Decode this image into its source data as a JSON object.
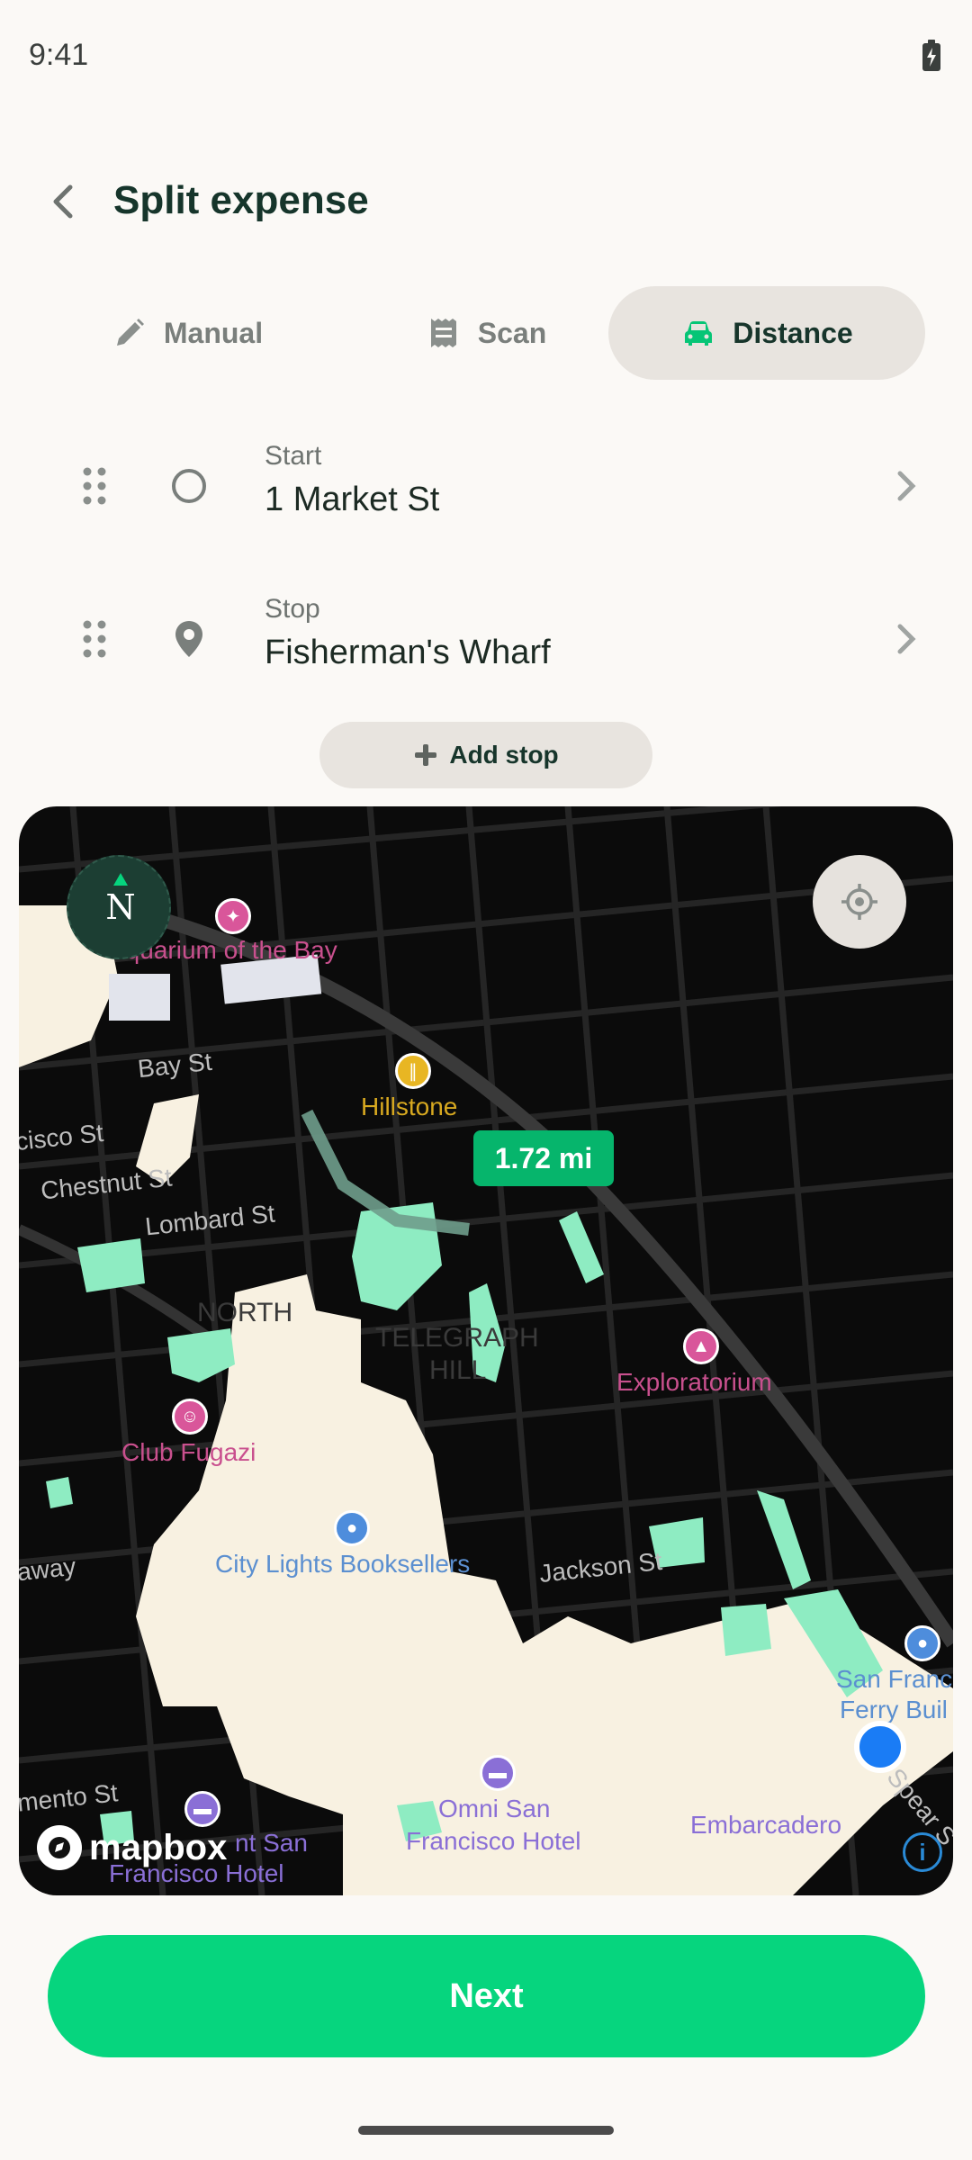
{
  "status": {
    "time": "9:41"
  },
  "header": {
    "title": "Split expense"
  },
  "tabs": [
    {
      "label": "Manual",
      "icon": "pencil-icon"
    },
    {
      "label": "Scan",
      "icon": "receipt-icon"
    },
    {
      "label": "Distance",
      "icon": "car-icon",
      "active": true
    }
  ],
  "route": {
    "start": {
      "label": "Start",
      "value": "1 Market St"
    },
    "stop": {
      "label": "Stop",
      "value": "Fisherman's Wharf"
    },
    "add_stop_label": "Add stop"
  },
  "map": {
    "distance": "1.72 mi",
    "compass": "N",
    "attribution": "mapbox",
    "info_glyph": "i",
    "streets": [
      "Bay St",
      "cisco St",
      "Chestnut St",
      "Lombard St",
      "Jackson St",
      "away",
      "mento St",
      "Spear S"
    ],
    "districts": [
      "NORTH",
      "TELEGRAPH",
      "HILL"
    ],
    "pois": [
      {
        "name": "Aquarium of the Bay",
        "color": "#D9569A"
      },
      {
        "name": "Hillstone",
        "color": "#E8B623"
      },
      {
        "name": "Exploratorium",
        "color": "#D9569A"
      },
      {
        "name": "Club Fugazi",
        "color": "#D9569A"
      },
      {
        "name": "City Lights Booksellers",
        "color": "#4E8DDC"
      },
      {
        "name": "Omni San",
        "color": "#8A6FD6"
      },
      {
        "name": "Francisco Hotel",
        "color": "#8A6FD6"
      },
      {
        "name": "nt San",
        "color": "#8A6FD6"
      },
      {
        "name": "Francisco Hotel",
        "color": "#8A6FD6"
      },
      {
        "name": "San Franc",
        "color": "#4E8DDC"
      },
      {
        "name": "Ferry Buil",
        "color": "#4E8DDC"
      },
      {
        "name": "Embarcadero",
        "color": "#8A6FD6"
      }
    ],
    "colors": {
      "land": "#F8F1E1",
      "water": "#0B0B0B",
      "park": "#8EECC2",
      "road": "#2A2A2A"
    }
  },
  "footer": {
    "next_label": "Next"
  },
  "colors": {
    "accent": "#06D57E",
    "badge": "#06B56C",
    "primary_text": "#16352B"
  }
}
